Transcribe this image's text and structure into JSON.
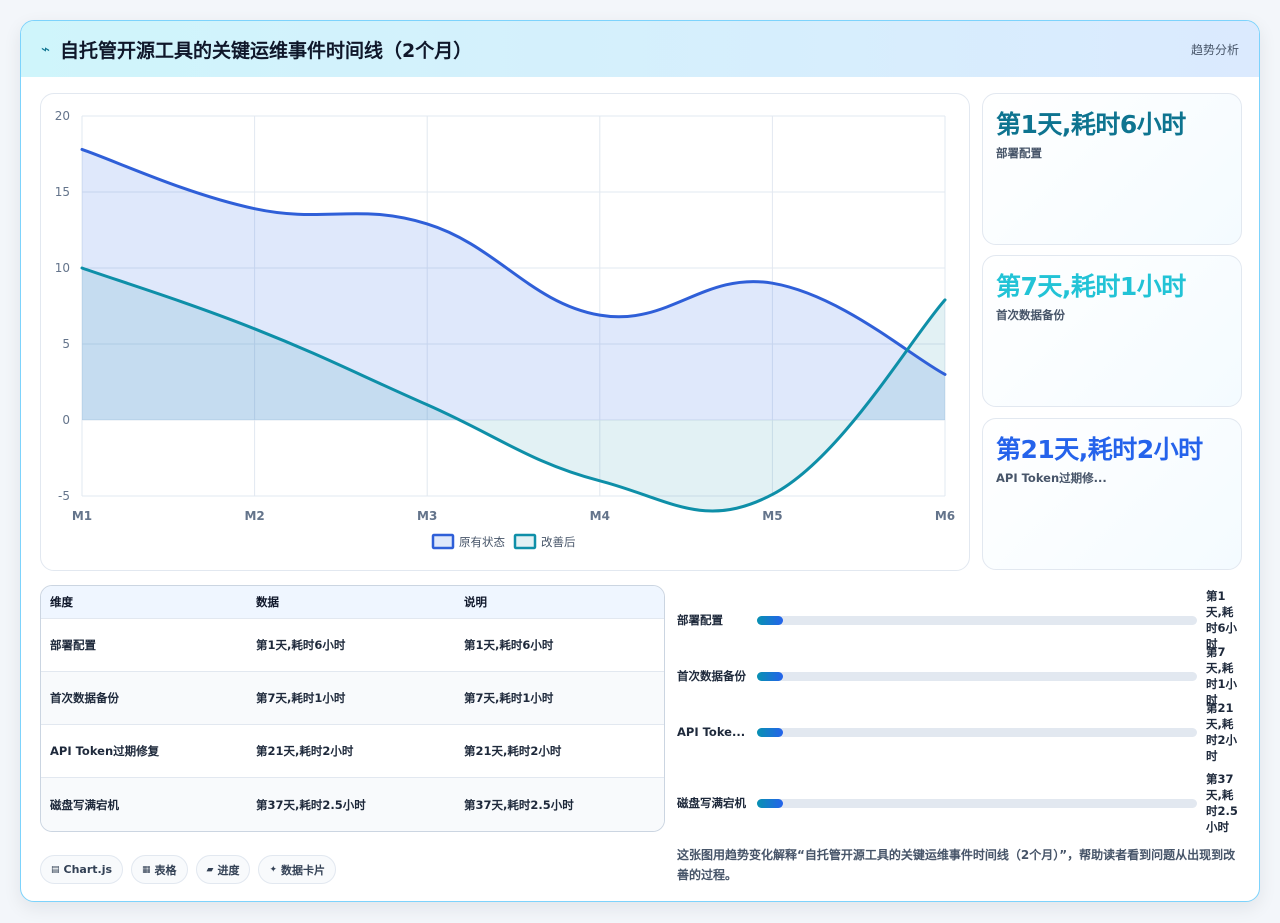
{
  "header": {
    "title": "自托管开源工具的关键运维事件时间线（2个月）",
    "trend_label": "趋势分析"
  },
  "stats": [
    {
      "value": "第1天,耗时6小时",
      "label": "部署配置",
      "color": "#0e7490"
    },
    {
      "value": "第7天,耗时1小时",
      "label": "首次数据备份",
      "color": "#22c3d6"
    },
    {
      "value": "第21天,耗时2小时",
      "label": "API Token过期修...",
      "color": "#2563eb"
    }
  ],
  "table": {
    "headers": [
      "维度",
      "数据",
      "说明"
    ],
    "rows": [
      [
        "部署配置",
        "第1天,耗时6小时",
        "第1天,耗时6小时"
      ],
      [
        "首次数据备份",
        "第7天,耗时1小时",
        "第7天,耗时1小时"
      ],
      [
        "API Token过期修复",
        "第21天,耗时2小时",
        "第21天,耗时2小时"
      ],
      [
        "磁盘写满宕机",
        "第37天,耗时2.5小时",
        "第37天,耗时2.5小时"
      ]
    ]
  },
  "progress": [
    {
      "label": "部署配置",
      "value": "第1天,耗时6小时",
      "fraction": 0.06
    },
    {
      "label": "首次数据备份",
      "value": "第7天,耗时1小时",
      "fraction": 0.06
    },
    {
      "label": "API Toke...",
      "value": "第21天,耗时2小时",
      "fraction": 0.06
    },
    {
      "label": "磁盘写满宕机",
      "value": "第37天,耗时2.5小时",
      "fraction": 0.06
    }
  ],
  "tags": [
    {
      "icon": "chart-icon",
      "glyph": "▤",
      "label": "Chart.js"
    },
    {
      "icon": "table-icon",
      "glyph": "▦",
      "label": "表格"
    },
    {
      "icon": "progress-icon",
      "glyph": "▰",
      "label": "进度"
    },
    {
      "icon": "sparkle-icon",
      "glyph": "✦",
      "label": "数据卡片"
    }
  ],
  "caption": "这张图用趋势变化解释“自托管开源工具的关键运维事件时间线（2个月）”，帮助读者看到问题从出现到改善的过程。",
  "chart_data": {
    "type": "area",
    "categories": [
      "M1",
      "M2",
      "M3",
      "M4",
      "M5",
      "M6"
    ],
    "series": [
      {
        "name": "原有状态",
        "values": [
          17.8,
          13.9,
          12.9,
          6.9,
          9,
          3
        ],
        "color": "#2f5fd8",
        "fill": "rgba(59,110,230,0.16)"
      },
      {
        "name": "改善后",
        "values": [
          10,
          6,
          1,
          -4,
          -4.9,
          7.9
        ],
        "color": "#0e8fa8",
        "fill": "rgba(14,143,168,0.12)"
      }
    ],
    "ylim": [
      -5,
      20
    ],
    "yticks": [
      -5,
      0,
      5,
      10,
      15,
      20
    ],
    "grid": true,
    "legend_position": "bottom"
  }
}
